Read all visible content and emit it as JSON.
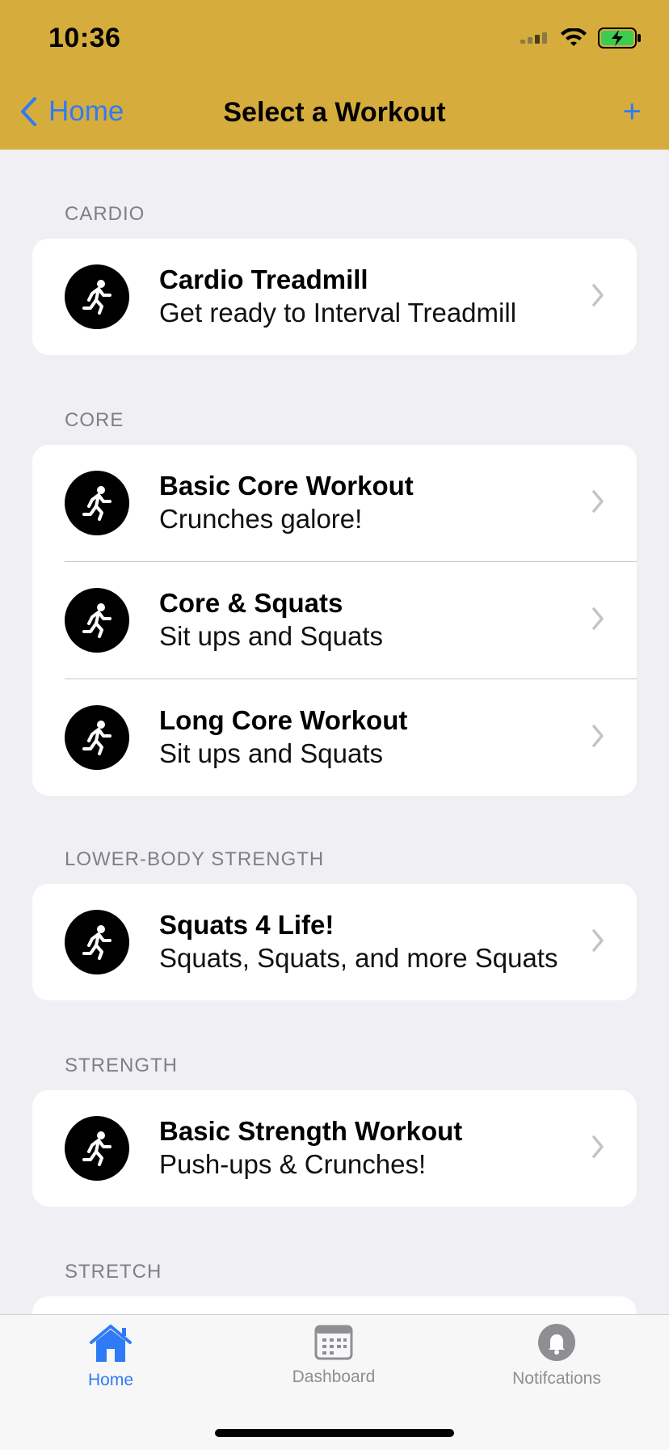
{
  "status_bar": {
    "time": "10:36"
  },
  "nav": {
    "back_label": "Home",
    "title": "Select a Workout",
    "add_label": "+"
  },
  "sections": [
    {
      "header": "CARDIO",
      "items": [
        {
          "title": "Cardio Treadmill",
          "subtitle": "Get ready to Interval Treadmill"
        }
      ]
    },
    {
      "header": "CORE",
      "items": [
        {
          "title": "Basic Core Workout",
          "subtitle": "Crunches galore!"
        },
        {
          "title": "Core & Squats",
          "subtitle": "Sit ups and Squats"
        },
        {
          "title": "Long Core Workout",
          "subtitle": "Sit ups and Squats"
        }
      ]
    },
    {
      "header": "LOWER-BODY STRENGTH",
      "items": [
        {
          "title": "Squats 4 Life!",
          "subtitle": "Squats, Squats, and more Squats"
        }
      ]
    },
    {
      "header": "STRENGTH",
      "items": [
        {
          "title": "Basic Strength Workout",
          "subtitle": "Push-ups & Crunches!"
        }
      ]
    },
    {
      "header": "STRETCH",
      "items": []
    }
  ],
  "tabbar": {
    "tabs": [
      {
        "label": "Home",
        "icon": "house-icon",
        "active": true
      },
      {
        "label": "Dashboard",
        "icon": "calendar-icon",
        "active": false
      },
      {
        "label": "Notifcations",
        "icon": "bell-icon",
        "active": false
      }
    ]
  },
  "colors": {
    "header_bg": "#d6ad3c",
    "accent": "#2f7bf6",
    "background": "#efeff4"
  }
}
